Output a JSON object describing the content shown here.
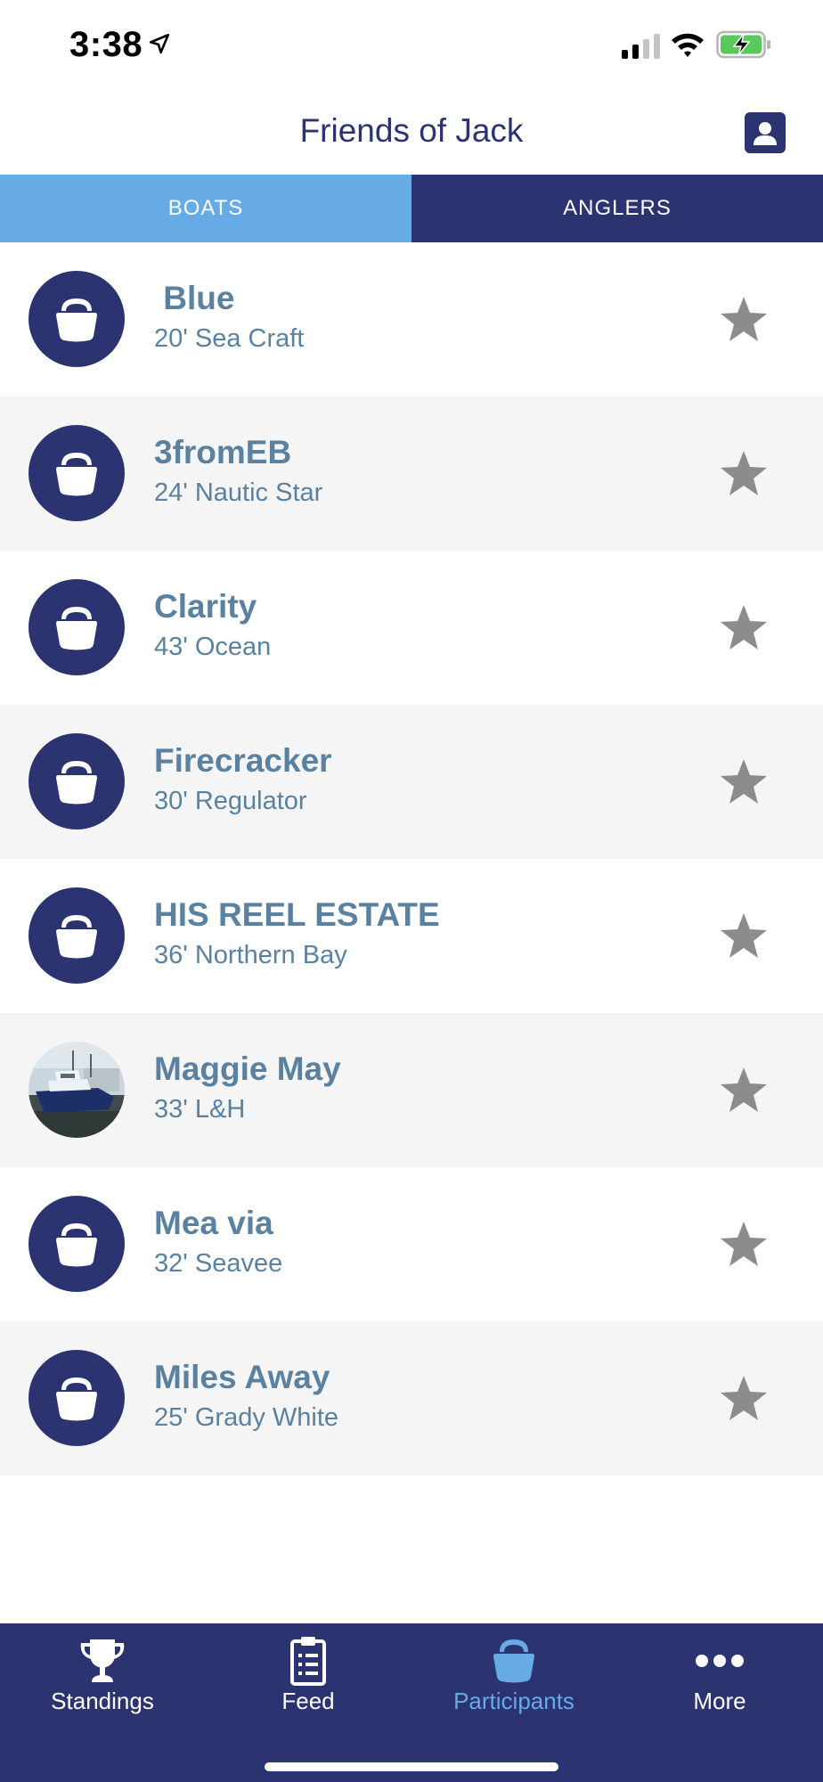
{
  "status_bar": {
    "time": "3:38"
  },
  "header": {
    "title": "Friends of Jack",
    "profile_icon": "person-icon"
  },
  "tabs": [
    {
      "label": "BOATS",
      "active": true
    },
    {
      "label": "ANGLERS",
      "active": false
    }
  ],
  "boats": [
    {
      "name": " Blue",
      "description": "20' Sea Craft",
      "avatar": "boat-icon"
    },
    {
      "name": "3fromEB",
      "description": "24' Nautic Star",
      "avatar": "boat-icon"
    },
    {
      "name": "Clarity",
      "description": "43' Ocean",
      "avatar": "boat-icon"
    },
    {
      "name": "Firecracker",
      "description": "30' Regulator",
      "avatar": "boat-icon"
    },
    {
      "name": "HIS REEL ESTATE",
      "description": "36' Northern Bay",
      "avatar": "boat-icon"
    },
    {
      "name": "Maggie May",
      "description": "33' L&H",
      "avatar": "boat-photo"
    },
    {
      "name": "Mea via",
      "description": "32' Seavee",
      "avatar": "boat-icon"
    },
    {
      "name": "Miles Away",
      "description": "25' Grady White",
      "avatar": "boat-icon"
    }
  ],
  "bottom_nav": [
    {
      "label": "Standings",
      "icon": "trophy-icon",
      "active": false
    },
    {
      "label": "Feed",
      "icon": "clipboard-icon",
      "active": false
    },
    {
      "label": "Participants",
      "icon": "boat-icon",
      "active": true
    },
    {
      "label": "More",
      "icon": "more-dots-icon",
      "active": false
    }
  ],
  "colors": {
    "primary": "#2b3370",
    "accent": "#66aae6",
    "text": "#5a82a0",
    "star": "#8c8c8c"
  }
}
